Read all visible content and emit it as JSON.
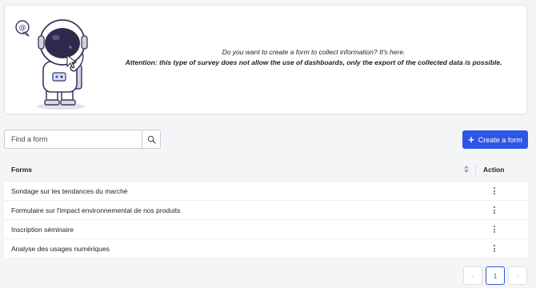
{
  "banner": {
    "line1": "Do you want to create a form to collect information? It's here.",
    "line2": "Attention: this type of survey does not allow the use of dashboards, only the export of the collected data is possible.",
    "mascot_icon": "astronaut-mascot",
    "speech_symbol": "@"
  },
  "search": {
    "placeholder": "Find a form",
    "value": "",
    "icon": "search-icon"
  },
  "create_button": {
    "label": "Create a form",
    "icon": "plus-icon"
  },
  "table": {
    "columns": [
      "Forms",
      "Action"
    ],
    "rows": [
      {
        "name": "Sondage sur les tendances du marché"
      },
      {
        "name": "Formulaire sur l'impact environnemental de nos produits"
      },
      {
        "name": "Inscription séminaire"
      },
      {
        "name": "Analyse des usages numériques"
      }
    ]
  },
  "pagination": {
    "prev": "‹",
    "current_page": "1",
    "next": "›"
  },
  "colors": {
    "accent": "#2f55e4",
    "background": "#f4f5f7",
    "card": "#ffffff"
  }
}
